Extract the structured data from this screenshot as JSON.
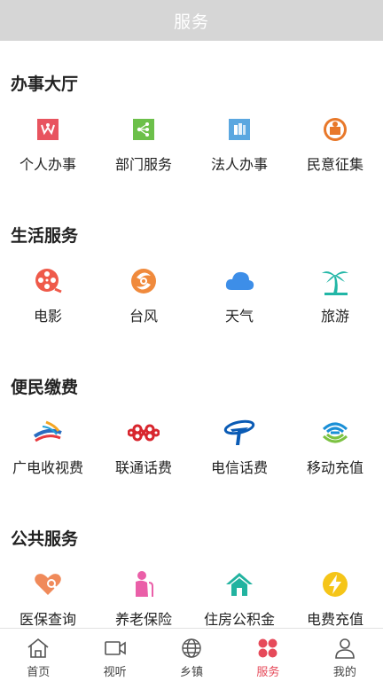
{
  "header": {
    "title": "服务"
  },
  "sections": [
    {
      "title": "办事大厅",
      "items": [
        {
          "label": "个人办事",
          "icon": "personal-affairs-icon",
          "color": "#e8545f"
        },
        {
          "label": "部门服务",
          "icon": "department-service-icon",
          "color": "#6cc04a"
        },
        {
          "label": "法人办事",
          "icon": "legal-person-icon",
          "color": "#5aa7e0"
        },
        {
          "label": "民意征集",
          "icon": "public-opinion-icon",
          "color": "#e8782a"
        }
      ]
    },
    {
      "title": "生活服务",
      "items": [
        {
          "label": "电影",
          "icon": "film-reel-icon",
          "color": "#ef5a4a"
        },
        {
          "label": "台风",
          "icon": "typhoon-icon",
          "color": "#f08a3c"
        },
        {
          "label": "天气",
          "icon": "cloud-icon",
          "color": "#3d8ee8"
        },
        {
          "label": "旅游",
          "icon": "palm-tree-icon",
          "color": "#21b6a6"
        }
      ]
    },
    {
      "title": "便民缴费",
      "items": [
        {
          "label": "广电收视费",
          "icon": "broadcast-tv-logo-icon",
          "color": "#2a6cc0"
        },
        {
          "label": "联通话费",
          "icon": "china-unicom-logo-icon",
          "color": "#d8262e"
        },
        {
          "label": "电信话费",
          "icon": "china-telecom-logo-icon",
          "color": "#0a5bb5"
        },
        {
          "label": "移动充值",
          "icon": "china-mobile-logo-icon",
          "color": "#1a8fd6"
        }
      ]
    },
    {
      "title": "公共服务",
      "items": [
        {
          "label": "医保查询",
          "icon": "medical-insurance-icon",
          "color": "#f08a5a"
        },
        {
          "label": "养老保险",
          "icon": "elderly-icon",
          "color": "#ea5fa8"
        },
        {
          "label": "住房公积金",
          "icon": "house-icon",
          "color": "#22b3a0"
        },
        {
          "label": "电费充值",
          "icon": "lightning-icon",
          "color": "#f5c518"
        }
      ]
    }
  ],
  "tabbar": {
    "active_color": "#e64a5a",
    "tabs": [
      {
        "label": "首页",
        "icon": "home-icon"
      },
      {
        "label": "视听",
        "icon": "video-camera-icon"
      },
      {
        "label": "乡镇",
        "icon": "globe-icon"
      },
      {
        "label": "服务",
        "icon": "four-dots-icon",
        "active": true
      },
      {
        "label": "我的",
        "icon": "user-icon"
      }
    ]
  }
}
